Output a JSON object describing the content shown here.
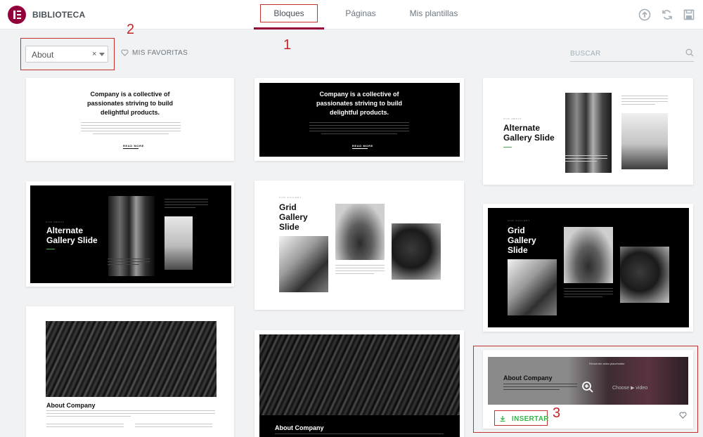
{
  "header": {
    "brand": "BIBLIOTECA",
    "tabs": [
      {
        "label": "Bloques"
      },
      {
        "label": "Páginas"
      },
      {
        "label": "Mis plantillas"
      }
    ],
    "icons": [
      "upload-icon",
      "sync-icon",
      "save-icon"
    ]
  },
  "toolbar": {
    "filter_value": "About",
    "filter_clear": "×",
    "favorites_label": "MIS FAVORITAS",
    "search_placeholder": "BUSCAR"
  },
  "annotations": [
    "1",
    "2",
    "3"
  ],
  "cards": {
    "collective": {
      "title": "Company is a collective of passionates striving to build delightful products.",
      "link": "READ MORE"
    },
    "alternate": {
      "kicker": "OUR ABOUT",
      "title": "Alternate Gallery Slide"
    },
    "grid": {
      "kicker": "OUR GALLERY",
      "title": "Grid Gallery Slide"
    },
    "about": {
      "title": "About Company"
    },
    "hovered": {
      "title": "About Company",
      "video_title": "Elementor video placeholder",
      "video_label": "Choose ▶ video",
      "insert_label": "INSERTAR"
    }
  },
  "colors": {
    "brand": "#92003b",
    "active_tab": "#93003c",
    "insert_green": "#39b54a",
    "annotation_red": "#c53030"
  }
}
